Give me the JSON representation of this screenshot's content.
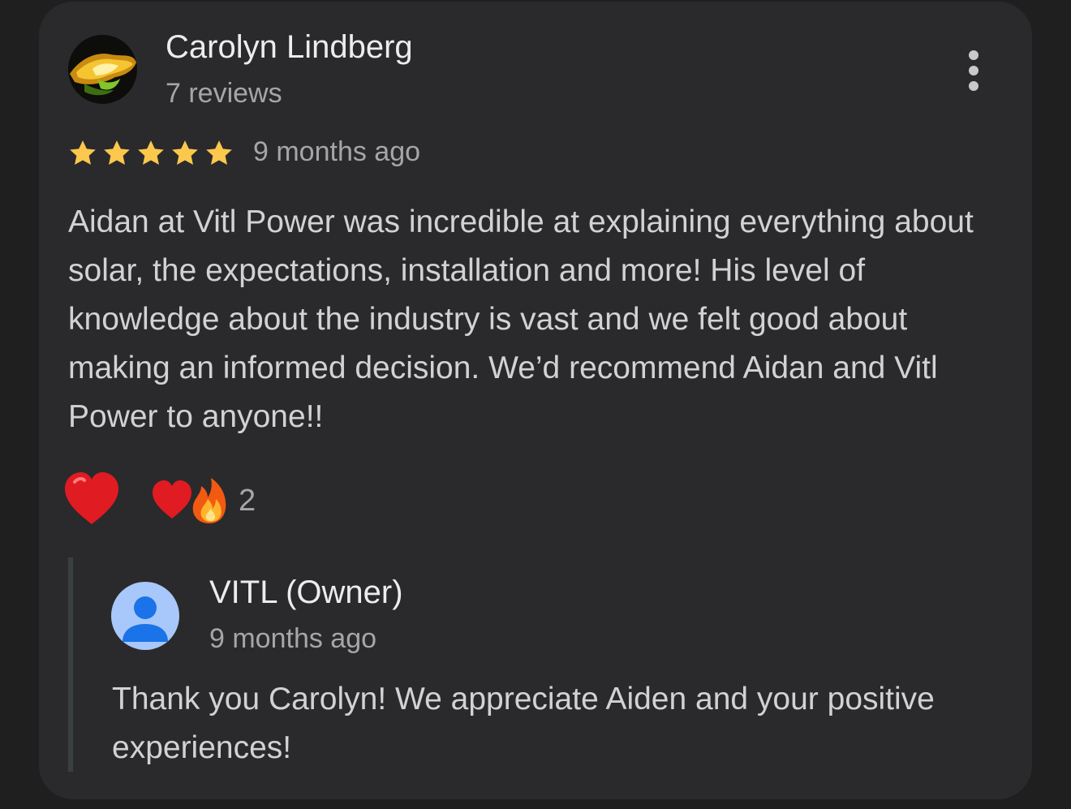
{
  "review": {
    "author": "Carolyn Lindberg",
    "review_count": "7 reviews",
    "rating": 5,
    "date": "9 months ago",
    "text": "Aidan at Vitl Power was incredible at explaining everything about solar, the expectations, installation and more! His level of knowledge about the industry is vast and we felt good about making an informed decision. We’d recommend Aidan and Vitl Power to anyone!!",
    "reactions": {
      "add_reaction_icon": "red-heart-icon",
      "summary_icons": [
        "red-heart-icon",
        "fire-icon"
      ],
      "count": "2"
    }
  },
  "owner_reply": {
    "name": "VITL (Owner)",
    "date": "9 months ago",
    "text": "Thank you Carolyn! We appreciate Aiden and your positive experiences!"
  },
  "colors": {
    "background": "#1f1f20",
    "card": "#2a2a2c",
    "primary_text": "#ececec",
    "body_text": "#d2d2d4",
    "secondary_text": "#a6a6a8",
    "star": "#fbc74d",
    "owner_avatar_bg": "#a8c7fa",
    "owner_avatar_fg": "#1a73e8"
  }
}
